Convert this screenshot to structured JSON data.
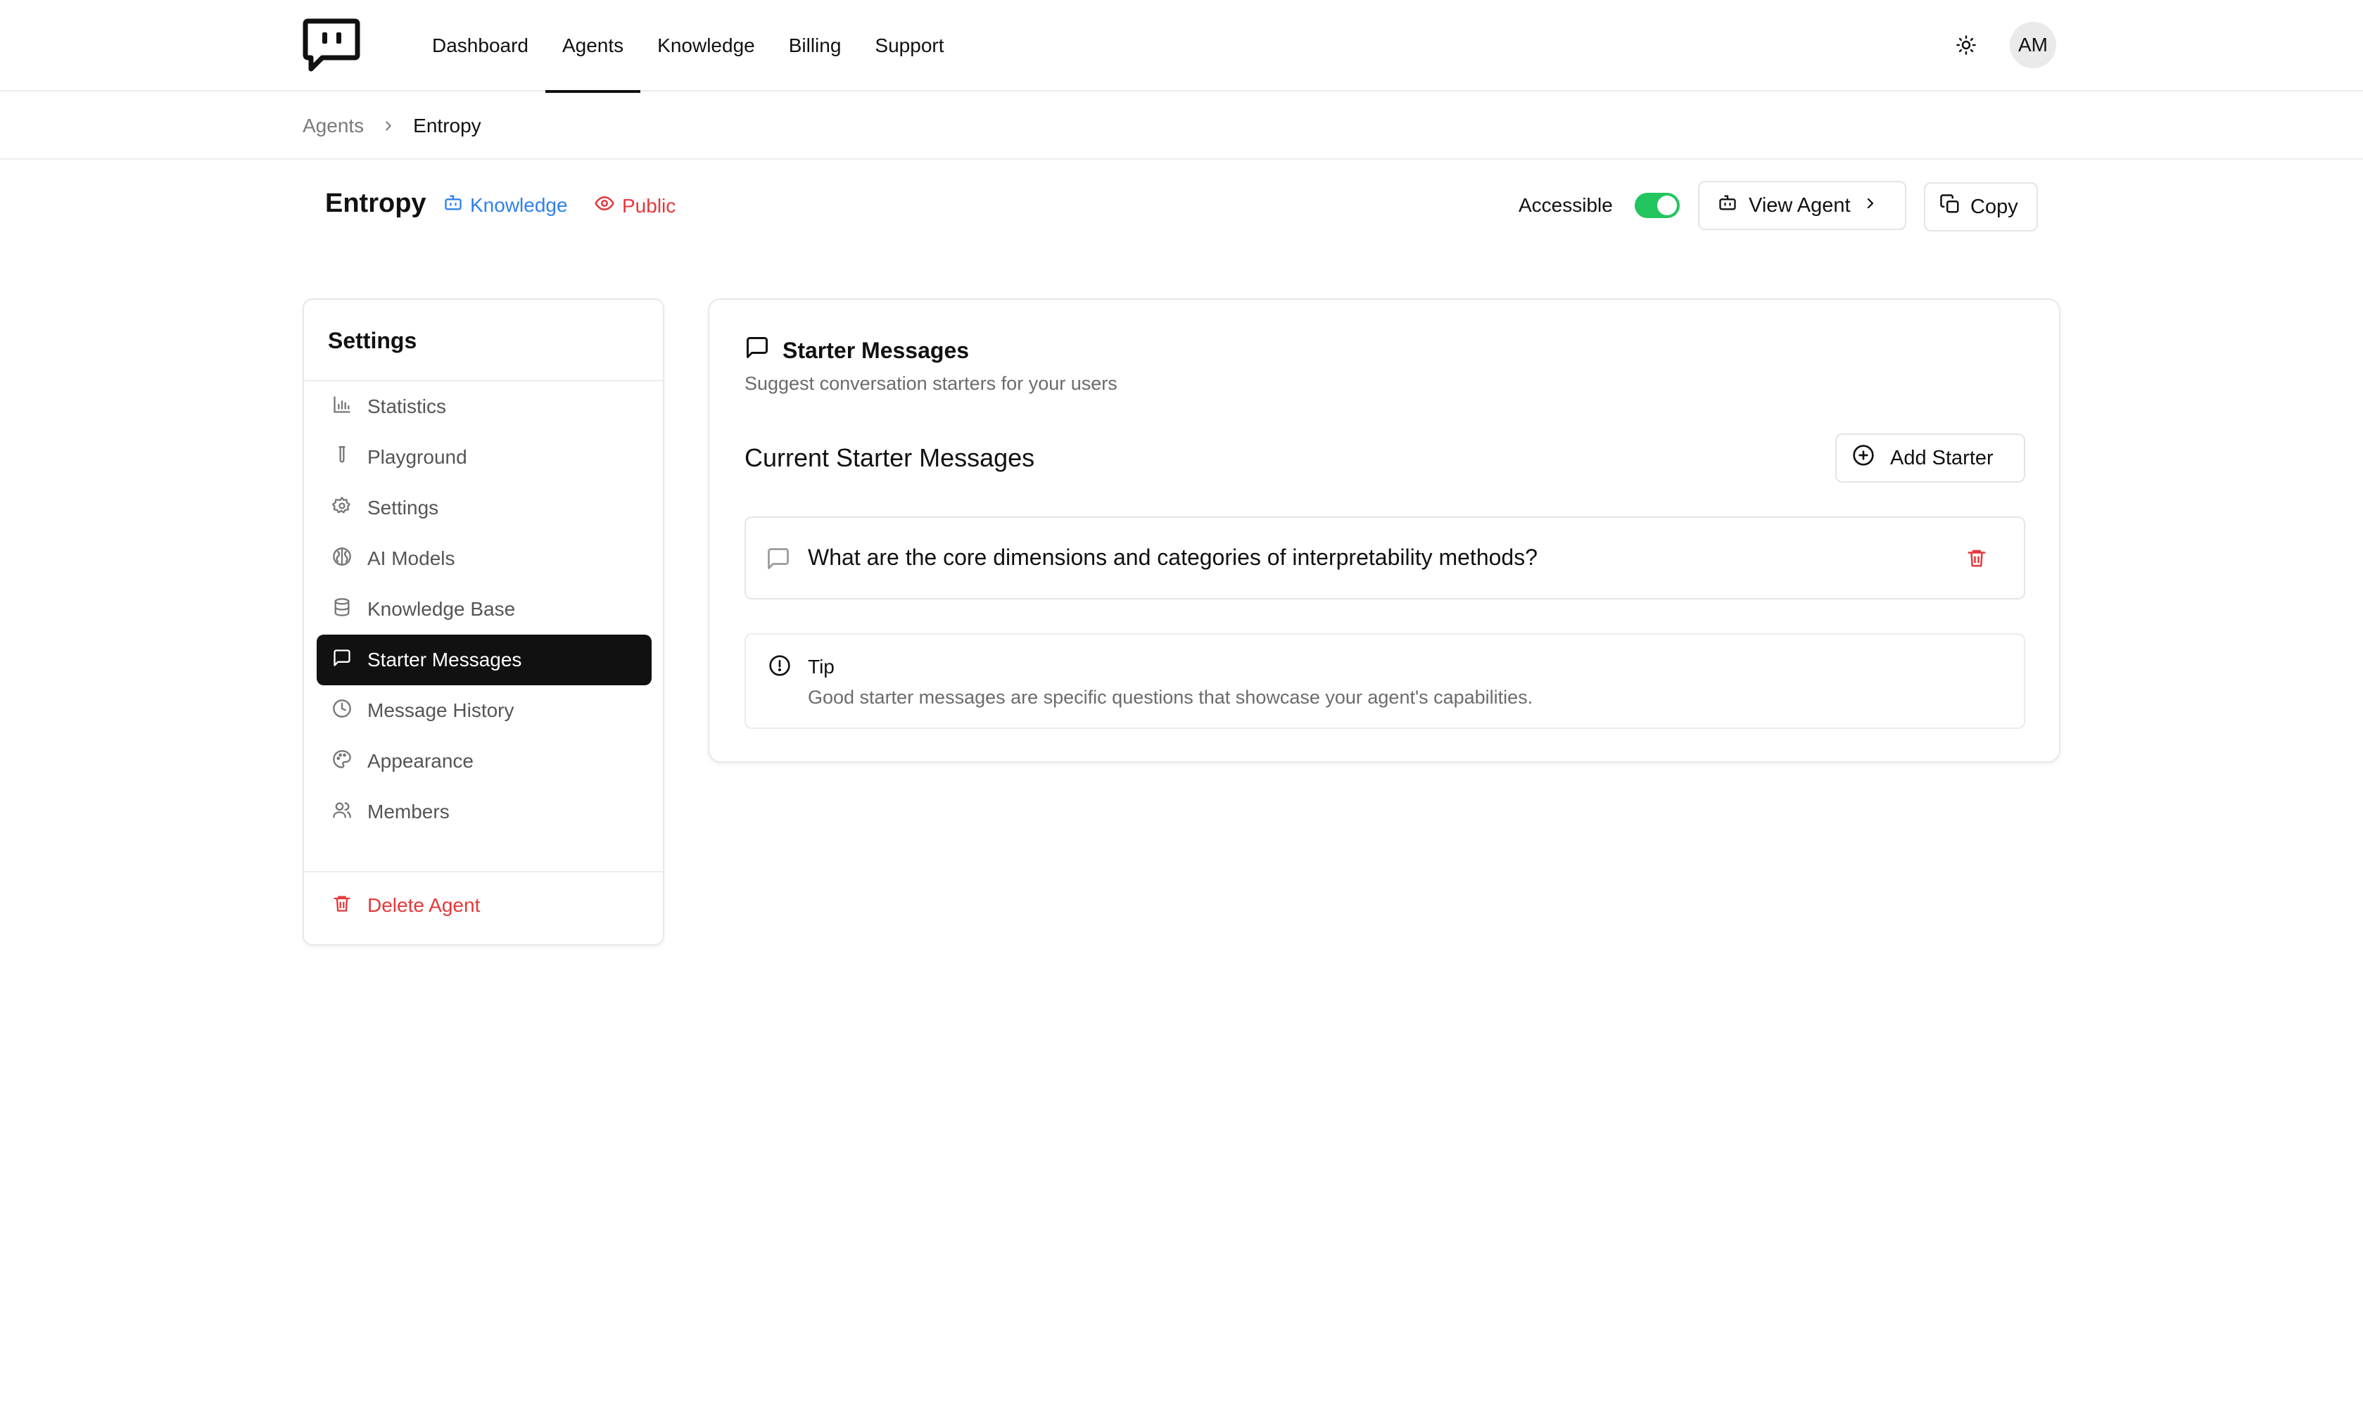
{
  "nav": {
    "items": [
      "Dashboard",
      "Agents",
      "Knowledge",
      "Billing",
      "Support"
    ],
    "active": "Agents"
  },
  "user": {
    "initials": "AM"
  },
  "breadcrumb": {
    "parent": "Agents",
    "current": "Entropy"
  },
  "agent": {
    "name": "Entropy",
    "knowledge_tag": "Knowledge",
    "visibility_tag": "Public",
    "accessible_label": "Accessible",
    "accessible_on": true,
    "view_button": "View Agent",
    "copy_button": "Copy"
  },
  "sidebar": {
    "title": "Settings",
    "items": [
      {
        "label": "Statistics",
        "icon": "bar-chart-icon"
      },
      {
        "label": "Playground",
        "icon": "test-tube-icon"
      },
      {
        "label": "Settings",
        "icon": "gear-icon"
      },
      {
        "label": "AI Models",
        "icon": "brain-icon"
      },
      {
        "label": "Knowledge Base",
        "icon": "database-icon"
      },
      {
        "label": "Starter Messages",
        "icon": "message-square-icon"
      },
      {
        "label": "Message History",
        "icon": "clock-icon"
      },
      {
        "label": "Appearance",
        "icon": "palette-icon"
      },
      {
        "label": "Members",
        "icon": "users-icon"
      }
    ],
    "active": "Starter Messages",
    "delete_label": "Delete Agent"
  },
  "main": {
    "title": "Starter Messages",
    "subtitle": "Suggest conversation starters for your users",
    "section_title": "Current Starter Messages",
    "add_button": "Add Starter",
    "starters": [
      "What are the core dimensions and categories of interpretability methods?"
    ],
    "tip": {
      "title": "Tip",
      "text": "Good starter messages are specific questions that showcase your agent's capabilities."
    }
  },
  "colors": {
    "accent_dark": "#111111",
    "link_blue": "#2f80ed",
    "danger_red": "#e5383b",
    "toggle_green": "#22c55e"
  }
}
